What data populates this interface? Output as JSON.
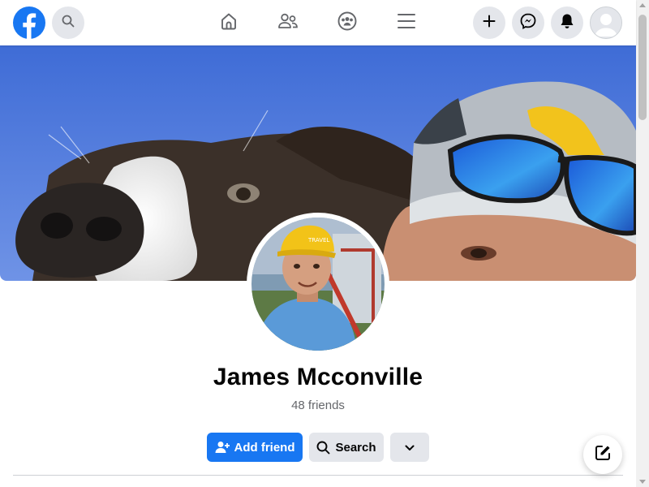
{
  "header": {
    "logo_icon": "facebook-logo-icon",
    "search_icon": "search-icon",
    "nav_tabs": [
      {
        "icon": "home-icon"
      },
      {
        "icon": "friends-icon"
      },
      {
        "icon": "groups-icon"
      },
      {
        "icon": "menu-icon"
      }
    ],
    "actions": [
      {
        "icon": "plus-icon"
      },
      {
        "icon": "messenger-icon"
      },
      {
        "icon": "bell-icon"
      }
    ],
    "account_icon": "avatar-icon"
  },
  "profile": {
    "name": "James Mcconville",
    "friends_count": "48 friends"
  },
  "actions": {
    "add_friend_label": "Add friend",
    "search_label": "Search",
    "more_icon": "chevron-down-icon"
  },
  "floating": {
    "compose_icon": "compose-icon"
  },
  "colors": {
    "brand_blue": "#1877f2",
    "button_gray": "#e4e6eb",
    "secondary_text": "#65676b"
  }
}
